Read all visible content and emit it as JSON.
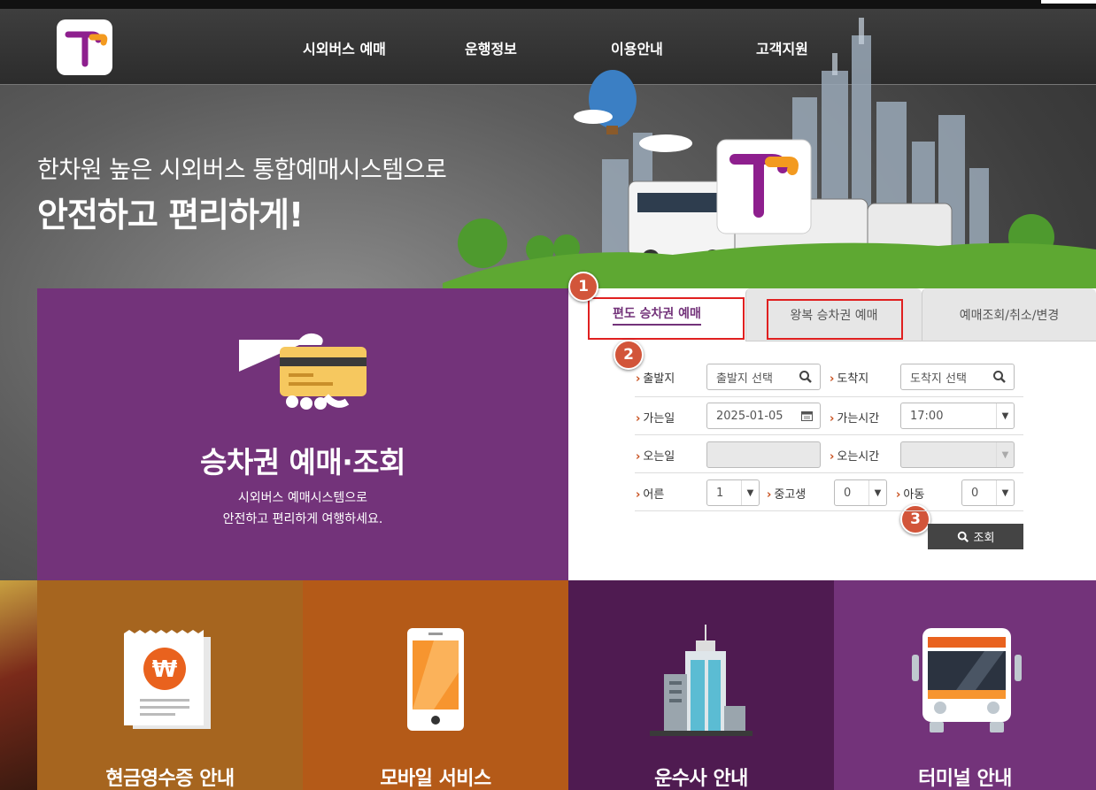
{
  "colors": {
    "accent_purple": "#73337a",
    "badge": "#d2553a",
    "highlight_box": "#e02020",
    "tile_receipt": "#a6651f",
    "tile_mobile": "#b45a18",
    "tile_company": "#4f1b51",
    "tile_terminal": "#73337a"
  },
  "header": {
    "logo_icon": "t-logo-icon",
    "nav": [
      "시외버스 예매",
      "운행정보",
      "이용안내",
      "고객지원"
    ]
  },
  "hero": {
    "subtitle": "한차원 높은 시외버스 통합예매시스템으로",
    "title": "안전하고 편리하게!"
  },
  "panel": {
    "icon": "card-in-hand-icon",
    "title": "승차권 예매·조회",
    "desc_line1": "시외버스 예매시스템으로",
    "desc_line2": "안전하고 편리하게 여행하세요."
  },
  "tabs": [
    {
      "label": "편도 승차권 예매",
      "active": true
    },
    {
      "label": "왕복 승차권 예매",
      "active": false
    },
    {
      "label": "예매조회/취소/변경",
      "active": false
    }
  ],
  "badges": [
    "1",
    "2",
    "3"
  ],
  "form": {
    "departure_label": "출발지",
    "departure_placeholder": "출발지 선택",
    "arrival_label": "도착지",
    "arrival_placeholder": "도착지 선택",
    "go_date_label": "가는일",
    "go_date_value": "2025-01-05",
    "go_time_label": "가는시간",
    "go_time_value": "17:00",
    "return_date_label": "오는일",
    "return_date_value": "",
    "return_time_label": "오는시간",
    "return_time_value": "",
    "adult_label": "어른",
    "adult_value": "1",
    "student_label": "중고생",
    "student_value": "0",
    "child_label": "아동",
    "child_value": "0",
    "search_button": "조회"
  },
  "tiles": [
    {
      "label": "현금영수증 안내",
      "icon": "receipt-won-icon"
    },
    {
      "label": "모바일 서비스",
      "icon": "smartphone-icon"
    },
    {
      "label": "운수사 안내",
      "icon": "building-icon"
    },
    {
      "label": "터미널 안내",
      "icon": "bus-front-icon"
    }
  ]
}
